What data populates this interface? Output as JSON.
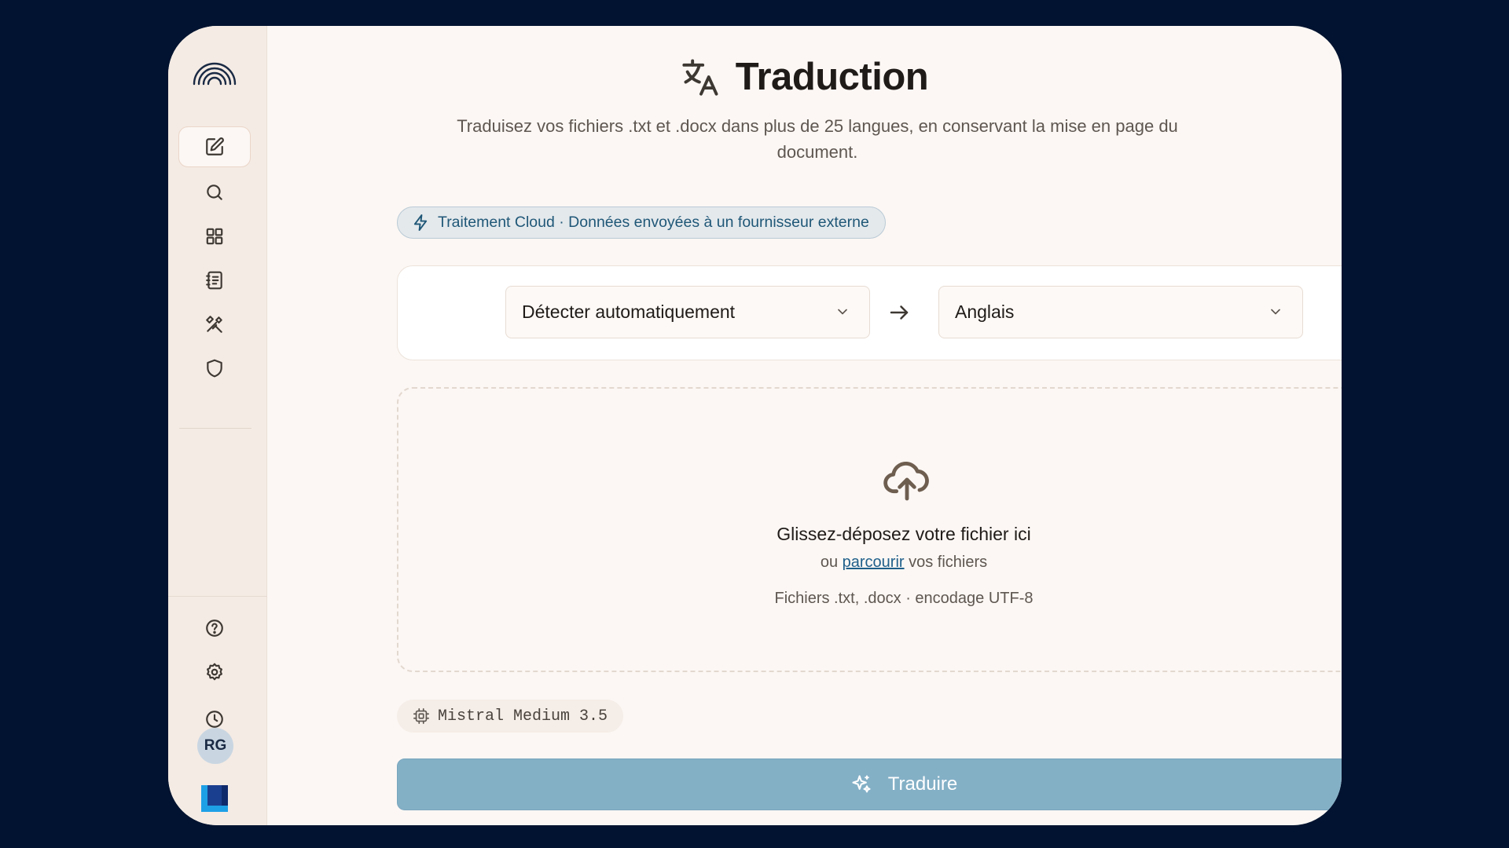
{
  "header": {
    "title": "Traduction",
    "subtitle": "Traduisez vos fichiers .txt et .docx dans plus de 25 langues, en conservant la mise en page du document."
  },
  "badge": {
    "label": "Traitement Cloud · Données envoyées à un fournisseur externe"
  },
  "languages": {
    "source": "Détecter automatiquement",
    "target": "Anglais"
  },
  "dropzone": {
    "title": "Glissez-déposez votre fichier ici",
    "browse_prefix": "ou",
    "browse_link": "parcourir",
    "browse_suffix": "vos fichiers",
    "formats": "Fichiers .txt, .docx · encodage UTF-8"
  },
  "model": {
    "name": "Mistral Medium 3.5"
  },
  "actions": {
    "translate_label": "Traduire"
  },
  "user": {
    "initials": "RG"
  },
  "sidebar": {
    "icons": [
      "edit-icon",
      "search-icon",
      "grid-icon",
      "notebook-icon",
      "tools-icon",
      "shield-icon",
      "help-icon",
      "settings-icon",
      "history-icon"
    ]
  },
  "colors": {
    "background": "#011330",
    "sidebar": "#f4ebe4",
    "surface": "#fcf7f4",
    "accent_button": "#84b0c6",
    "badge_text": "#1f5777",
    "link": "#1f5f8a"
  }
}
